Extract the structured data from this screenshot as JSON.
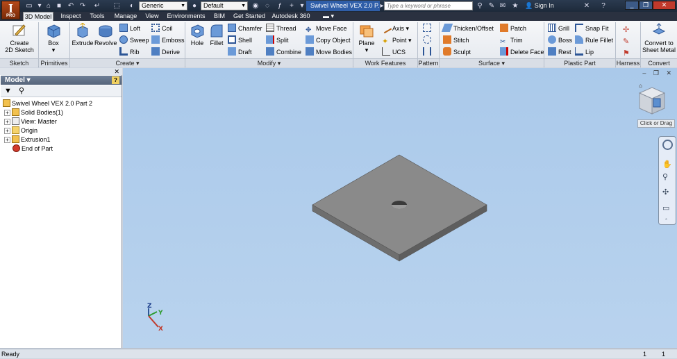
{
  "app": {
    "logo_letter": "I",
    "logo_sub": "PRO",
    "document_title": "Swivel Wheel VEX 2.0 P...",
    "material_dropdown": "Generic",
    "appearance_dropdown": "Default",
    "search_placeholder": "Type a keyword or phrase",
    "sign_in": "Sign In"
  },
  "tabs": [
    "3D Model",
    "Inspect",
    "Tools",
    "Manage",
    "View",
    "Environments",
    "BIM",
    "Get Started",
    "Autodesk 360"
  ],
  "ribbon": {
    "create_sketch": "Create\n2D Sketch",
    "box": "Box",
    "extrude": "Extrude",
    "revolve": "Revolve",
    "loft": "Loft",
    "sweep": "Sweep",
    "rib": "Rib",
    "coil": "Coil",
    "emboss": "Emboss",
    "derive": "Derive",
    "hole": "Hole",
    "fillet": "Fillet",
    "chamfer": "Chamfer",
    "shell": "Shell",
    "draft": "Draft",
    "thread": "Thread",
    "split": "Split",
    "combine": "Combine",
    "move_face": "Move Face",
    "copy_object": "Copy Object",
    "move_bodies": "Move Bodies",
    "plane": "Plane",
    "axis": "Axis",
    "point": "Point",
    "ucs": "UCS",
    "thicken_offset": "Thicken/Offset",
    "stitch": "Stitch",
    "sculpt": "Sculpt",
    "patch": "Patch",
    "trim": "Trim",
    "delete_face": "Delete Face",
    "grill": "Grill",
    "boss": "Boss",
    "rest": "Rest",
    "snap_fit": "Snap Fit",
    "rule_fillet": "Rule Fillet",
    "lip": "Lip",
    "convert_sheet_metal": "Convert to\nSheet Metal",
    "groups": {
      "sketch": "Sketch",
      "primitives": "Primitives",
      "create": "Create ▾",
      "modify": "Modify ▾",
      "work_features": "Work Features",
      "pattern": "Pattern",
      "surface": "Surface ▾",
      "plastic_part": "Plastic Part",
      "harness": "Harness",
      "convert": "Convert"
    }
  },
  "browser": {
    "header": "Model ▾",
    "help": "?",
    "tree": [
      {
        "label": "Swivel Wheel VEX 2.0 Part 2"
      },
      {
        "label": "Solid Bodies(1)"
      },
      {
        "label": "View: Master"
      },
      {
        "label": "Origin"
      },
      {
        "label": "Extrusion1"
      },
      {
        "label": "End of Part"
      }
    ]
  },
  "viewport": {
    "viewcube_tooltip": "Click or Drag",
    "axis_x": "X",
    "axis_y": "Y",
    "axis_z": "Z"
  },
  "status": {
    "text": "Ready",
    "n1": "1",
    "n2": "1"
  },
  "colors": {
    "background_top": "#aac9ea",
    "part_top": "#8a8a8a",
    "part_side": "#6a6a6a"
  }
}
